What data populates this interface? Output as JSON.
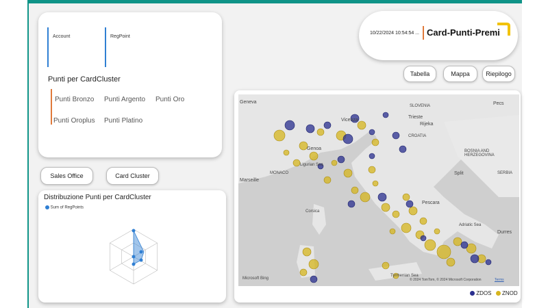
{
  "kpis": {
    "account": "Account",
    "regpoint": "RegPoint"
  },
  "slicer": {
    "title": "Punti per CardCluster",
    "items": [
      "Punti Bronzo",
      "Punti Argento",
      "Punti Oro",
      "Punti Oroplus",
      "Punti Platino"
    ]
  },
  "filters": {
    "sales_office": "Sales Office",
    "card_cluster": "Card Cluster"
  },
  "radar": {
    "title": "Distribuzione Punti per CardCluster",
    "legend": "Sum of RegPoints",
    "color": "#2f7fd3"
  },
  "header": {
    "timestamp": "10/22/2024 10:54:54 ...",
    "title": "Card-Punti-Premi"
  },
  "nav": {
    "tabella": "Tabella",
    "mappa": "Mappa",
    "riepilogo": "Riepilogo"
  },
  "map": {
    "labels": {
      "geneva": "Geneva",
      "slovenia": "SLOVENIA",
      "pecs": "Pecs",
      "vicenza": "Vicenza",
      "trieste": "Trieste",
      "rijeka": "Rijeka",
      "croatia": "CROATIA",
      "genoa": "Genoa",
      "ligurian_sea": "Ligurian Sea",
      "monaco": "MONACO",
      "marseille": "Marseille",
      "bosnia": "BOSNIA AND HERZEGOVINA",
      "split": "Split",
      "serbia": "SERBIA",
      "pescara": "Pescara",
      "corsica": "Corsica",
      "adriatic_sea": "Adriatic Sea",
      "durres": "Durres",
      "tyrrhenian_sea": "Tyrrhenian Sea",
      "bing": "Microsoft Bing",
      "copyright": "© 2024 TomTom, © 2024 Microsoft Corporation",
      "terms": "Terms"
    },
    "legend": [
      {
        "label": "ZDOS",
        "color": "#2a2f8f"
      },
      {
        "label": "ZNOD",
        "color": "#d6b51e"
      }
    ]
  }
}
